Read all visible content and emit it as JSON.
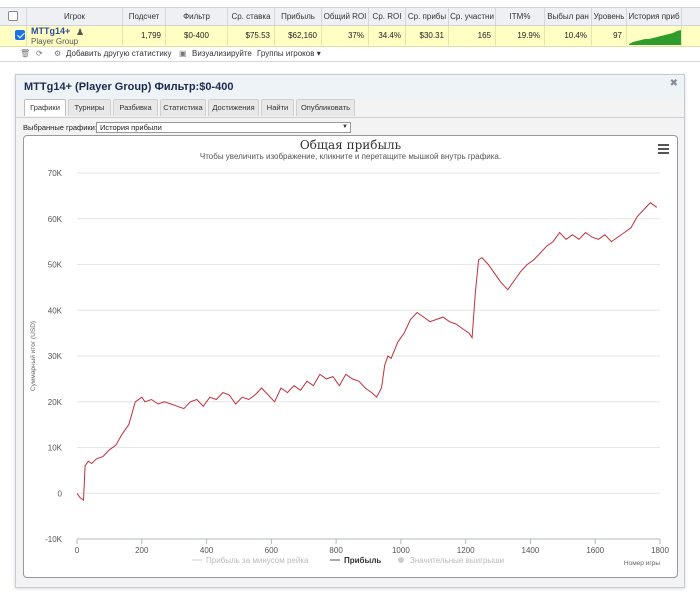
{
  "table": {
    "headers": [
      "Игрок",
      "Подсчет",
      "Фильтр",
      "Ср. ставка",
      "Прибыль",
      "Общий ROI",
      "Ср. ROI",
      "Ср. прибы",
      "Ср. участни",
      "ITM%",
      "Выбыл ран",
      "Уровень",
      "История приб"
    ],
    "row": {
      "player": "MTTg14+",
      "group": "Player Group",
      "count": "1,799",
      "filter": "$0-400",
      "avg_stake": "$75.53",
      "profit": "$62,160",
      "total_roi": "37%",
      "avg_roi": "34.4%",
      "avg_profit": "$30.31",
      "avg_entrants": "165",
      "itm": "19.9%",
      "early_out": "10.4%",
      "level": "97"
    }
  },
  "toolbar": {
    "add_stats": "Добавить другую статистику",
    "visualize": "Визуализируйте",
    "player_groups": "Группы игроков"
  },
  "panel": {
    "title": "MTTg14+ (Player Group) Фильтр:$0-400",
    "tabs": [
      "Графики",
      "Турниры",
      "Разбивка",
      "Статистика",
      "Достижения",
      "Найти",
      "Опубликовать"
    ],
    "active_tab": 0,
    "select_label": "Выбранные графики:",
    "select_value": "История прибыли"
  },
  "chart_data": {
    "type": "line",
    "title": "Общая прибыль",
    "subtitle": "Чтобы увеличить изображение, кликните и перетащите мышкой внутрь графика.",
    "xlabel": "Номер игры",
    "ylabel": "Суммарный итог (USD)",
    "xlim": [
      0,
      1800
    ],
    "ylim": [
      -10000,
      70000
    ],
    "xticks": [
      0,
      200,
      400,
      600,
      800,
      1000,
      1200,
      1400,
      1600,
      1800
    ],
    "yticks": [
      -10000,
      0,
      10000,
      20000,
      30000,
      40000,
      50000,
      60000,
      70000
    ],
    "ytick_labels": [
      "-10K",
      "0",
      "10K",
      "20K",
      "30K",
      "40K",
      "50K",
      "60K",
      "70K"
    ],
    "legend_placement": "bottom",
    "series": [
      {
        "name": "Прибыль за минусом рейка",
        "visible": false,
        "color": "#cccccc"
      },
      {
        "name": "Прибыль",
        "visible": true,
        "color": "#c0303a",
        "x": [
          0,
          10,
          20,
          25,
          35,
          45,
          60,
          80,
          100,
          120,
          140,
          160,
          180,
          200,
          210,
          230,
          250,
          270,
          290,
          310,
          330,
          350,
          370,
          390,
          410,
          430,
          450,
          470,
          490,
          510,
          530,
          550,
          570,
          590,
          610,
          630,
          650,
          670,
          690,
          710,
          730,
          750,
          770,
          790,
          810,
          830,
          850,
          870,
          890,
          910,
          925,
          940,
          950,
          960,
          970,
          990,
          1010,
          1030,
          1050,
          1070,
          1090,
          1110,
          1130,
          1150,
          1170,
          1190,
          1210,
          1220,
          1230,
          1240,
          1250,
          1270,
          1290,
          1310,
          1330,
          1350,
          1370,
          1390,
          1410,
          1430,
          1450,
          1470,
          1490,
          1510,
          1530,
          1550,
          1570,
          1590,
          1610,
          1630,
          1650,
          1670,
          1690,
          1710,
          1730,
          1750,
          1770,
          1790
        ],
        "y": [
          0,
          -1000,
          -1500,
          6000,
          7000,
          6500,
          7500,
          8000,
          9500,
          10500,
          13000,
          15000,
          20000,
          21000,
          20000,
          20500,
          19500,
          20000,
          19500,
          19000,
          18500,
          20000,
          20500,
          19000,
          21000,
          20500,
          22000,
          21500,
          19500,
          21000,
          20500,
          21500,
          23000,
          21500,
          20000,
          23000,
          22000,
          23500,
          22500,
          24500,
          23500,
          26000,
          25000,
          25500,
          23500,
          26000,
          25000,
          24500,
          23000,
          22000,
          21000,
          23000,
          28000,
          30000,
          29500,
          33000,
          35000,
          38000,
          39500,
          38500,
          37500,
          38000,
          38500,
          37500,
          37000,
          36000,
          35000,
          34000,
          44000,
          51000,
          51500,
          50000,
          48000,
          46000,
          44500,
          46500,
          48500,
          50000,
          51000,
          52500,
          54000,
          55000,
          57000,
          55500,
          56500,
          55500,
          57000,
          56000,
          55500,
          56500,
          55000,
          56000,
          57000,
          58000,
          60500,
          62000,
          63500,
          62500
        ]
      },
      {
        "name": "Значительные выигрыши",
        "visible": false,
        "color": "#cccccc"
      }
    ]
  },
  "colors": {
    "selected_row": "#ffffc4",
    "header_bg": "#eef0f4",
    "line": "#c0303a",
    "history_spark": "#2e9d2e"
  },
  "icons": {
    "player": "person-icon",
    "delete": "trash-icon",
    "refresh": "refresh-icon",
    "visualize": "image-icon",
    "close": "close-icon",
    "menu": "hamburger-menu-icon"
  }
}
